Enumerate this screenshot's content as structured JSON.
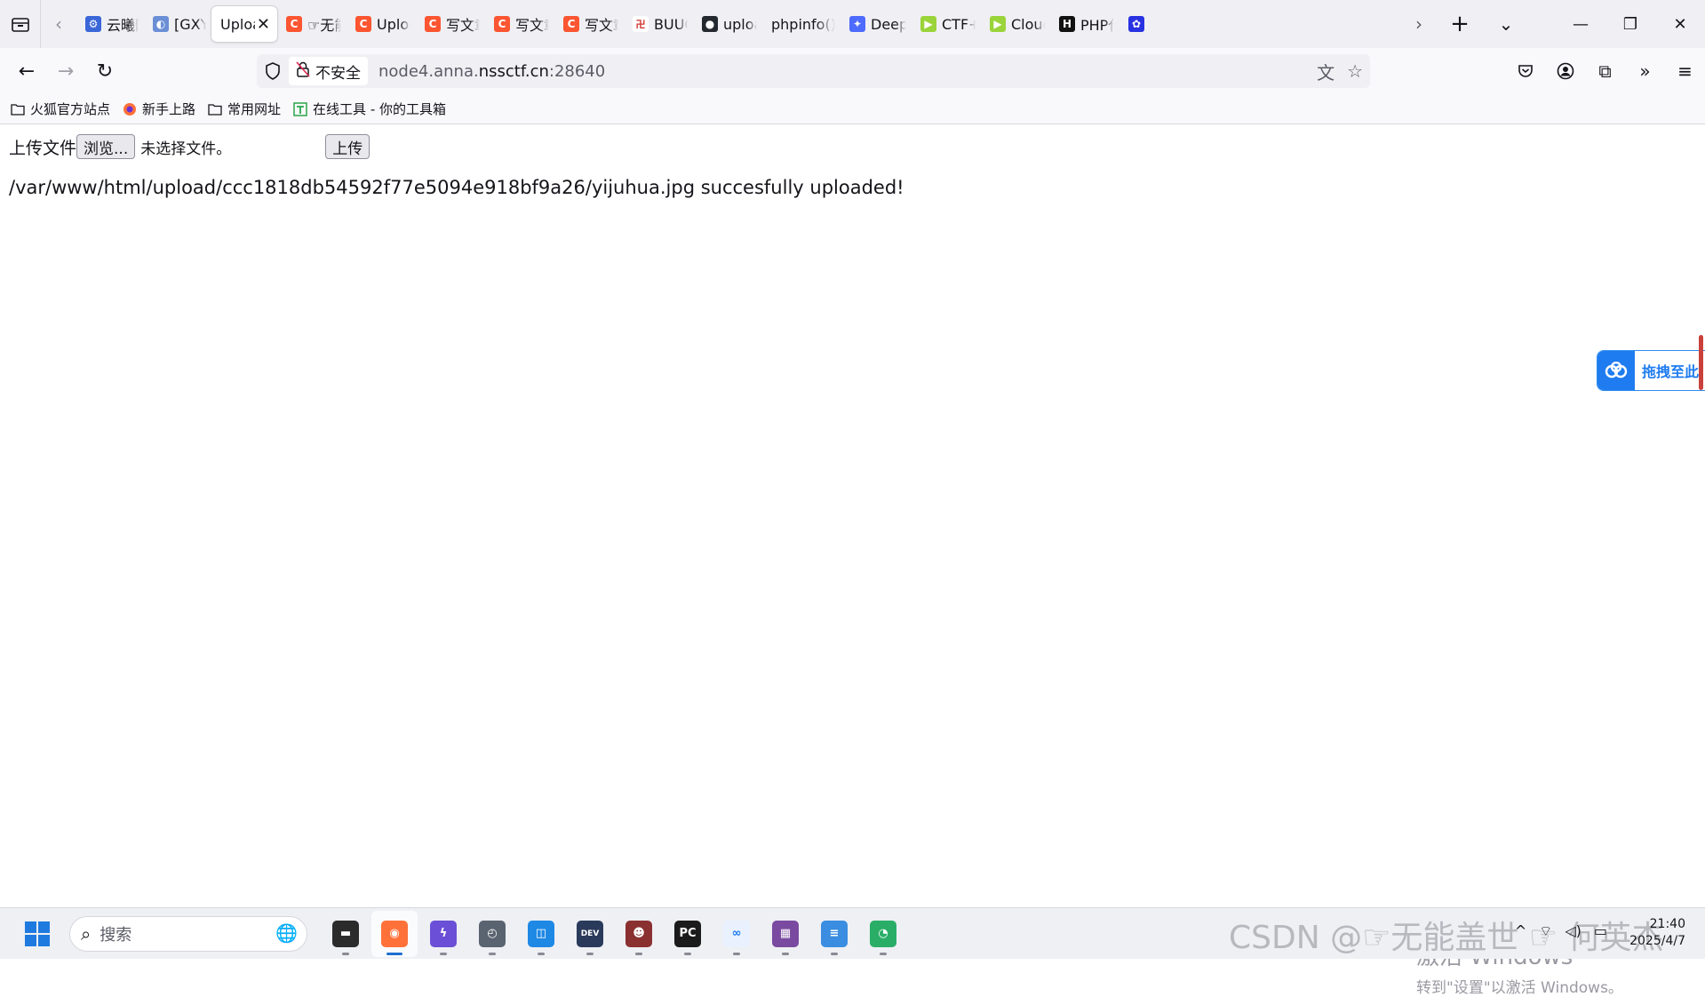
{
  "browser": {
    "tabs": [
      {
        "label": "云曦网",
        "fav_color": "#3a66d8",
        "fav_glyph": "⚙",
        "active": false
      },
      {
        "label": "[GXYC",
        "fav_color": "#6b8fd6",
        "fav_glyph": "◐",
        "active": false
      },
      {
        "label": "Upload",
        "fav_color": "",
        "fav_glyph": "",
        "active": true
      },
      {
        "label": "☞无能",
        "fav_color": "#fc5531",
        "fav_glyph": "C",
        "active": false
      },
      {
        "label": "Uploa",
        "fav_color": "#fc5531",
        "fav_glyph": "C",
        "active": false
      },
      {
        "label": "写文章",
        "fav_color": "#fc5531",
        "fav_glyph": "C",
        "active": false
      },
      {
        "label": "写文章",
        "fav_color": "#fc5531",
        "fav_glyph": "C",
        "active": false
      },
      {
        "label": "写文章",
        "fav_color": "#fc5531",
        "fav_glyph": "C",
        "active": false
      },
      {
        "label": "BUUC",
        "fav_color": "#ffffff",
        "fav_glyph": "卍",
        "active": false
      },
      {
        "label": "uploa",
        "fav_color": "#24292f",
        "fav_glyph": "●",
        "active": false
      },
      {
        "label": "phpinfo()",
        "fav_color": "",
        "fav_glyph": "",
        "active": false
      },
      {
        "label": "DeepS",
        "fav_color": "#4d6bfe",
        "fav_glyph": "✦",
        "active": false
      },
      {
        "label": "CTF+",
        "fav_color": "#9bd43a",
        "fav_glyph": "▶",
        "active": false
      },
      {
        "label": "Cloud",
        "fav_color": "#9bd43a",
        "fav_glyph": "▶",
        "active": false
      },
      {
        "label": "PHP代",
        "fav_color": "#111111",
        "fav_glyph": "H",
        "active": false
      }
    ],
    "tab_close_glyph": "✕",
    "url": {
      "security_label": "不安全",
      "host": "node4.anna.",
      "domain": "nssctf.cn",
      "port": ":28640"
    },
    "bookmarks": [
      {
        "label": "火狐官方站点",
        "icon": "folder-icon"
      },
      {
        "label": "新手上路",
        "icon": "firefox-icon"
      },
      {
        "label": "常用网址",
        "icon": "folder-icon"
      },
      {
        "label": "在线工具 - 你的工具箱",
        "icon": "tool-icon"
      }
    ]
  },
  "page": {
    "form_label": "上传文件",
    "browse_button": "浏览...",
    "no_file_text": "未选择文件。",
    "submit_button": "上传",
    "result_message": "/var/www/html/upload/ccc1818db54592f77e5094e918bf9a26/yijuhua.jpg succesfully uploaded!",
    "baidu_widget_text": "拖拽至此"
  },
  "windows": {
    "activate_title": "激活 Windows",
    "activate_sub": "转到\"设置\"以激活 Windows。"
  },
  "taskbar": {
    "search_placeholder": "搜索",
    "watermark": "CSDN @☞无能盖世 ☞ 何英杰",
    "time": "21:40",
    "date": "2025/4/7",
    "apps": [
      {
        "name": "file-explorer-app",
        "color": "#2b2b2b",
        "glyph": "▬",
        "active": false
      },
      {
        "name": "firefox-app",
        "color": "#ff7139",
        "glyph": "◉",
        "active": true
      },
      {
        "name": "visual-studio-app",
        "color": "#6b4fd6",
        "glyph": "ϟ",
        "active": false
      },
      {
        "name": "clock-app",
        "color": "#5a6470",
        "glyph": "◴",
        "active": false
      },
      {
        "name": "vmware-app",
        "color": "#1e88e5",
        "glyph": "◫",
        "active": false
      },
      {
        "name": "devc-app",
        "color": "#2a3a5a",
        "glyph": "DEV",
        "active": false
      },
      {
        "name": "game-app",
        "color": "#8a3030",
        "glyph": "☻",
        "active": false
      },
      {
        "name": "pycharm-app",
        "color": "#1b1b1b",
        "glyph": "PC",
        "active": false
      },
      {
        "name": "baidunetdisk-app",
        "color": "#e9f1ff",
        "glyph": "∞",
        "active": false
      },
      {
        "name": "winrar-app",
        "color": "#7a4aa0",
        "glyph": "▦",
        "active": false
      },
      {
        "name": "notepad-app",
        "color": "#3a8de0",
        "glyph": "≡",
        "active": false
      },
      {
        "name": "wechat-app",
        "color": "#2aae67",
        "glyph": "◔",
        "active": false
      }
    ]
  }
}
